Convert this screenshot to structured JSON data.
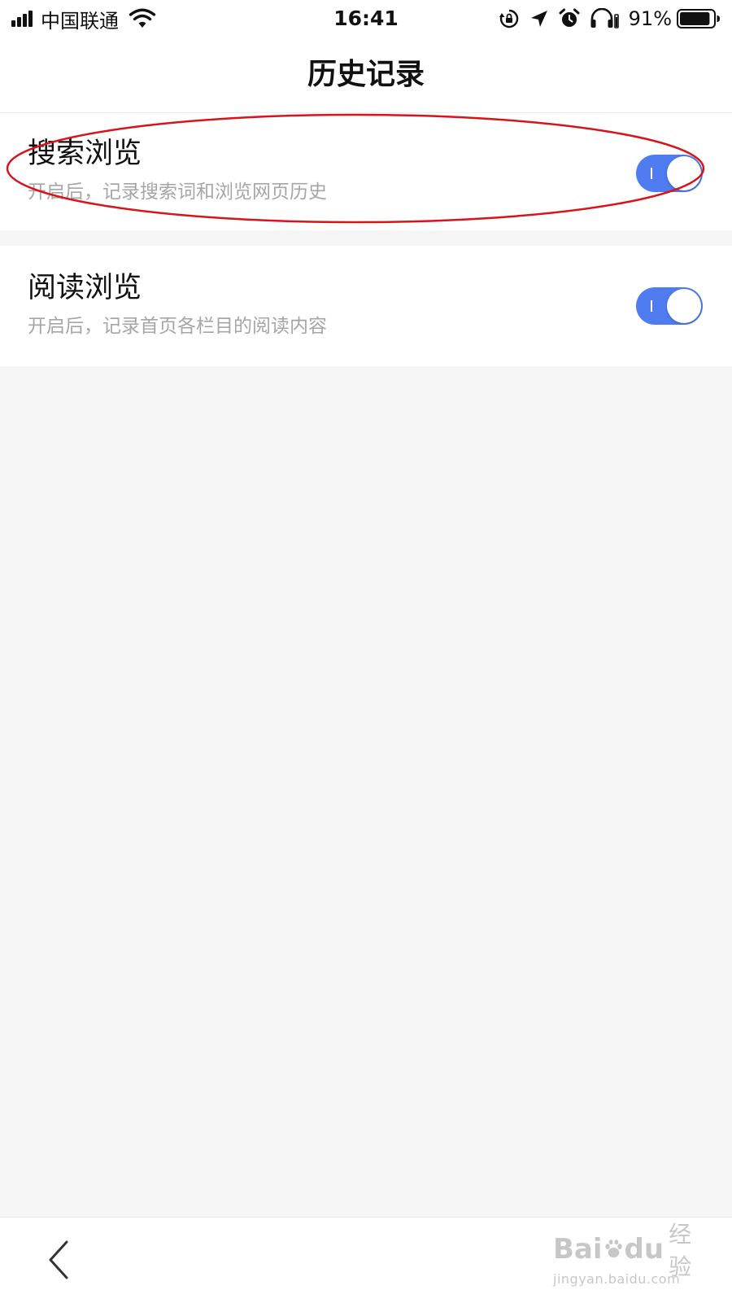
{
  "status_bar": {
    "carrier": "中国联通",
    "time": "16:41",
    "battery_percent": "91%",
    "battery_level": 0.91,
    "signal_bars": 4,
    "icons": [
      "signal-icon",
      "wifi-icon",
      "rotation-lock-icon",
      "location-arrow-icon",
      "alarm-icon",
      "headphones-icon",
      "battery-icon"
    ]
  },
  "nav": {
    "title": "历史记录"
  },
  "settings": [
    {
      "title": "搜索浏览",
      "description": "开启后，记录搜索词和浏览网页历史",
      "enabled": true
    },
    {
      "title": "阅读浏览",
      "description": "开启后，记录首页各栏目的阅读内容",
      "enabled": true
    }
  ],
  "bottom_bar": {
    "back_icon": "chevron-left-icon"
  },
  "watermark": {
    "logo_text_start": "Bai",
    "logo_text_end": "du",
    "brand": "经验",
    "url": "jingyan.baidu.com"
  },
  "colors": {
    "toggle_on": "#4f7cf0",
    "annotation": "#d8141b",
    "background": "#f5f5f5"
  }
}
